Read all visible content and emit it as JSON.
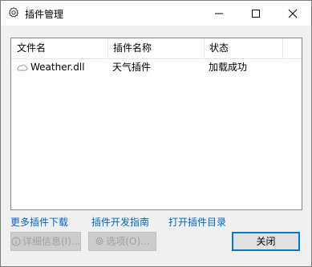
{
  "window": {
    "title": "插件管理",
    "icon": "gear-icon",
    "controls": {
      "minimize": "minimize-icon",
      "maximize": "maximize-icon",
      "close": "close-icon"
    }
  },
  "list": {
    "columns": [
      "文件名",
      "插件名称",
      "状态"
    ],
    "rows": [
      {
        "icon": "cloud-icon",
        "file": "Weather.dll",
        "name": "天气插件",
        "status": "加载成功"
      }
    ]
  },
  "links": [
    "更多插件下载",
    "插件开发指南",
    "打开插件目录"
  ],
  "buttons": {
    "details": "详细信息(I)...",
    "options": "选项(O)...",
    "close": "关闭"
  },
  "colors": {
    "link": "#0066cc",
    "accent": "#0078d7",
    "disabled_text": "#a0a0a0"
  }
}
